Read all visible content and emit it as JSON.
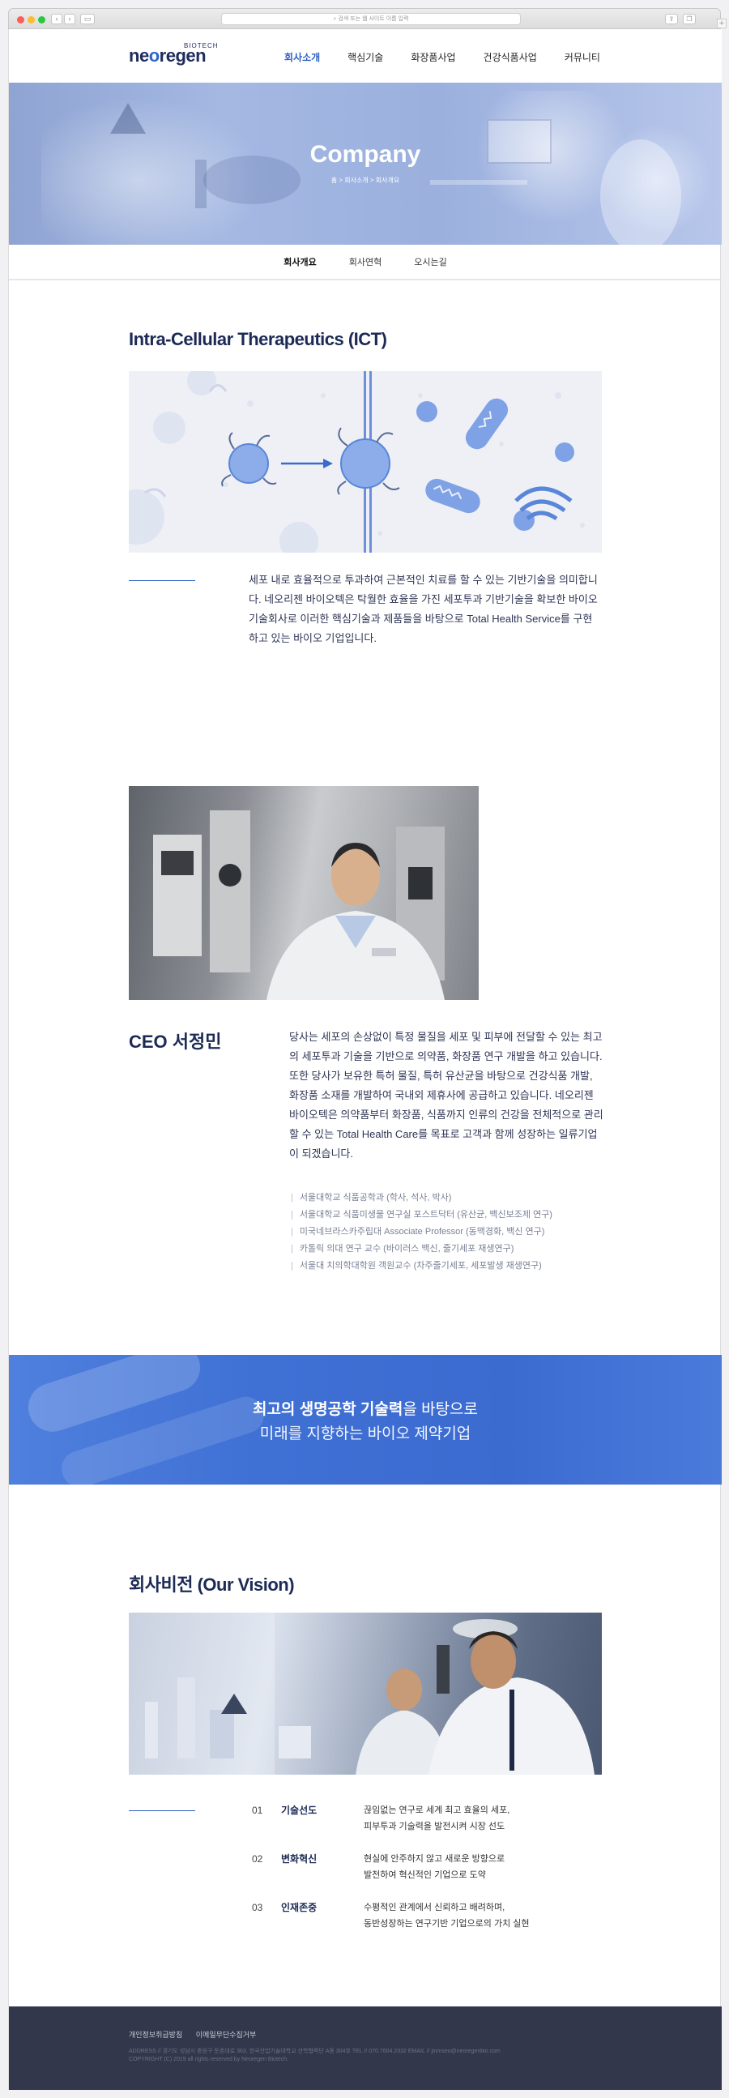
{
  "browser": {
    "address": "검색 또는 웹 사이트 이름 입력",
    "back": "‹",
    "forward": "›",
    "sidebar_icon": "sidebar-icon",
    "share_icon": "share-icon",
    "tabs_icon": "tabs-icon",
    "new_tab": "+"
  },
  "header": {
    "logo_biotech": "BIOTECH",
    "logo_text_1": "ne",
    "logo_text_o": "o",
    "logo_text_2": "regen",
    "nav": [
      "회사소개",
      "핵심기술",
      "화장품사업",
      "건강식품사업",
      "커뮤니티"
    ],
    "active_nav": "회사소개"
  },
  "hero": {
    "title": "Company",
    "breadcrumb": "홈 > 회사소개 > 회사개요"
  },
  "subnav": [
    "회사개요",
    "회사연혁",
    "오시는길"
  ],
  "ict": {
    "title": "Intra-Cellular Therapeutics (ICT)",
    "text": "세포 내로 효율적으로 투과하여 근본적인 치료를 할 수 있는 기반기술을 의미합니다. 네오리젠 바이오텍은 탁월한 효율을 가진 세포투과 기반기술을 확보한 바이오 기술회사로 이러한 핵심기술과 제품들을 바탕으로 Total Health Service를 구현하고 있는 바이오 기업입니다."
  },
  "ceo": {
    "name": "CEO 서정민",
    "text": "당사는 세포의 손상없이 특정 물질을 세포 및 피부에 전달할 수 있는 최고의 세포투과 기술을 기반으로 의약품, 화장품 연구 개발을 하고 있습니다. 또한 당사가 보유한 특허 물질, 특허 유산균을 바탕으로 건강식품 개발, 화장품 소재를 개발하여 국내외 제휴사에 공급하고 있습니다. 네오리젠 바이오텍은 의약품부터 화장품, 식품까지 인류의 건강을 전체적으로 관리할 수 있는 Total Health Care를 목표로 고객과 함께 성장하는 일류기업이 되겠습니다.",
    "career": [
      "서울대학교 식품공학과 (학사, 석사, 박사)",
      "서울대학교 식품미생물 연구실 포스트닥터 (유산균, 백신보조제 연구)",
      "미국네브라스카주립대 Associate Professor (동맥경화, 백신 연구)",
      "카톨릭 의대 연구 교수 (바이러스 백신, 줄기세포 재생연구)",
      "서울대 치의학대학원 객원교수 (차주줄기세포, 세포발생 재생연구)"
    ]
  },
  "banner": {
    "line1_bold": "최고의 생명공학 기술력",
    "line1_rest": "을 바탕으로",
    "line2": "미래를 지향하는 바이오 제약기업"
  },
  "vision": {
    "title": "회사비전 (Our Vision)",
    "items": [
      {
        "num": "01",
        "label": "기술선도",
        "desc1": "끊임없는 연구로 세계 최고 효율의 세포,",
        "desc2": "피부투과 기술력을 발전시켜 시장 선도"
      },
      {
        "num": "02",
        "label": "변화혁신",
        "desc1": "현실에 안주하지 않고 새로운 방향으로",
        "desc2": "발전하여 혁신적인 기업으로 도약"
      },
      {
        "num": "03",
        "label": "인재존중",
        "desc1": "수평적인 관계에서 신뢰하고 배려하며,",
        "desc2": "동반성장하는 연구기반 기업으로의 가치 실현"
      }
    ]
  },
  "footer": {
    "links": [
      "개인정보취급방침",
      "이메일무단수집거부"
    ],
    "address": "ADDRESS // 경기도 성남시 중원구 둔촌대로 363, 한국산업기술대학교 산학협력단 A동 304호  TEL // 070.7604.2332  EMAIL // jinmseo@neoregenbio.com",
    "copyright": "COPYRIGHT (C) 2019 all rights reserved by Neoregen Biotech."
  },
  "colors": {
    "brand_navy": "#1e2b5e",
    "accent_blue": "#2d5fc2",
    "banner_blue": "#3f70d4",
    "footer_bg": "#32374b"
  }
}
